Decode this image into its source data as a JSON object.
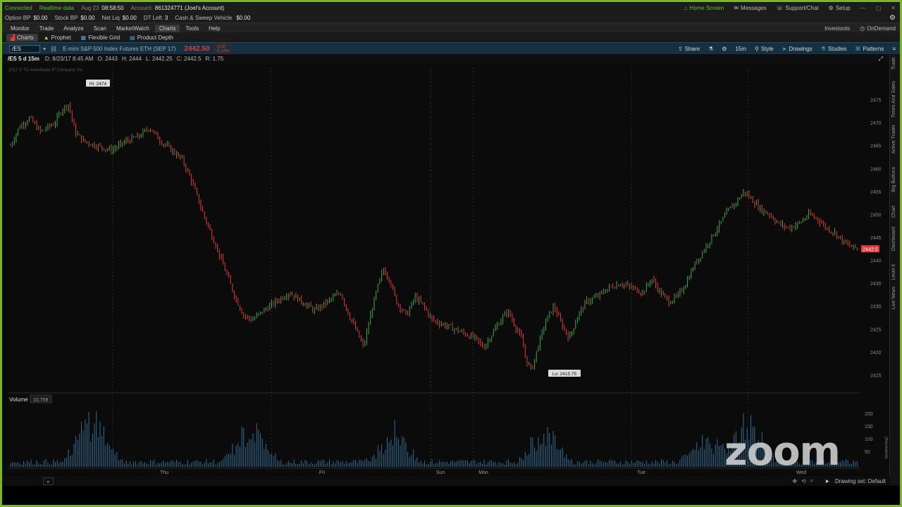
{
  "status_bar": {
    "connected": "Connected",
    "realtime": "Realtime data",
    "date": "Aug 23",
    "time": "08:58:50",
    "account_label": "Account:",
    "account": "861324771 (Joel's Account)",
    "home_screen": "Home Screen",
    "messages": "Messages",
    "support": "Support/Chat",
    "setup": "Setup"
  },
  "balances": {
    "option_bp_label": "Option BP",
    "option_bp": "$0.00",
    "stock_bp_label": "Stock BP",
    "stock_bp": "$0.00",
    "net_liq_label": "Net Liq",
    "net_liq": "$0.00",
    "dt_left_label": "DT Left",
    "dt_left": "3",
    "cash_label": "Cash & Sweep Vehicle",
    "cash": "$0.00"
  },
  "main_tabs": [
    "Monitor",
    "Trade",
    "Analyze",
    "Scan",
    "MarketWatch",
    "Charts",
    "Tools",
    "Help"
  ],
  "main_tabs_active": "Charts",
  "right_tabs": {
    "investools": "Investools",
    "ondemand": "OnDemand"
  },
  "sub_tabs": [
    "Charts",
    "Prophet",
    "Flexible Grid",
    "Product Depth"
  ],
  "symbol_bar": {
    "symbol": "/ES",
    "description": "E-mini S&P 500 Index Futures ETH (SEP 17)",
    "last": "2442.50",
    "change_top": "-3.50",
    "change_bottom": "-0.14%",
    "share": "Share",
    "timeframe": "15m",
    "style": "Style",
    "drawings": "Drawings",
    "studies": "Studies",
    "patterns": "Patterns"
  },
  "ohlc": {
    "header": "/ES 5 d 15m",
    "date": "D: 8/23/17 8:45 AM",
    "open": "O: 2443",
    "high": "H: 2444",
    "low": "L: 2442.25",
    "close": "C: 2442.5",
    "range": "R: 1.75",
    "copyright": "2017 © TD Ameritrade IP Company, Inc."
  },
  "chart_data": {
    "type": "candlestick",
    "x_labels": [
      "Thu",
      "Fri",
      "Sun",
      "Mon",
      "Tue",
      "Wed"
    ],
    "y_ticks": [
      2415,
      2420,
      2425,
      2430,
      2435,
      2440,
      2445,
      2450,
      2455,
      2460,
      2465,
      2470,
      2475
    ],
    "ylim": [
      2412,
      2482
    ],
    "hi_label": "Hi: 2474",
    "lo_label": "Lo: 2415.75",
    "last_price_tag": "2442.5",
    "path": [
      [
        0,
        2465
      ],
      [
        10,
        2469
      ],
      [
        22,
        2471
      ],
      [
        35,
        2468
      ],
      [
        52,
        2470
      ],
      [
        60,
        2473
      ],
      [
        68,
        2474
      ],
      [
        75,
        2468
      ],
      [
        85,
        2466
      ],
      [
        100,
        2465
      ],
      [
        118,
        2464
      ],
      [
        135,
        2466
      ],
      [
        150,
        2467
      ],
      [
        162,
        2469
      ],
      [
        175,
        2466
      ],
      [
        188,
        2464
      ],
      [
        200,
        2462
      ],
      [
        210,
        2458
      ],
      [
        225,
        2450
      ],
      [
        240,
        2443
      ],
      [
        252,
        2437
      ],
      [
        262,
        2432
      ],
      [
        272,
        2428
      ],
      [
        282,
        2427
      ],
      [
        295,
        2429
      ],
      [
        310,
        2431
      ],
      [
        325,
        2433
      ],
      [
        340,
        2431
      ],
      [
        355,
        2429
      ],
      [
        370,
        2431
      ],
      [
        385,
        2433
      ],
      [
        395,
        2428
      ],
      [
        405,
        2424
      ],
      [
        412,
        2421
      ],
      [
        420,
        2428
      ],
      [
        428,
        2434
      ],
      [
        435,
        2438
      ],
      [
        442,
        2436
      ],
      [
        450,
        2431
      ],
      [
        462,
        2428
      ],
      [
        472,
        2432
      ],
      [
        482,
        2430
      ],
      [
        492,
        2427
      ],
      [
        505,
        2426
      ],
      [
        518,
        2425
      ],
      [
        530,
        2424
      ],
      [
        542,
        2423
      ],
      [
        552,
        2421
      ],
      [
        562,
        2424
      ],
      [
        572,
        2427
      ],
      [
        580,
        2429
      ],
      [
        588,
        2426
      ],
      [
        596,
        2423
      ],
      [
        602,
        2418
      ],
      [
        608,
        2416
      ],
      [
        615,
        2421
      ],
      [
        625,
        2427
      ],
      [
        634,
        2430
      ],
      [
        643,
        2426
      ],
      [
        652,
        2423
      ],
      [
        662,
        2428
      ],
      [
        672,
        2431
      ],
      [
        684,
        2432
      ],
      [
        698,
        2434
      ],
      [
        712,
        2435
      ],
      [
        725,
        2434
      ],
      [
        738,
        2433
      ],
      [
        748,
        2436
      ],
      [
        758,
        2433
      ],
      [
        768,
        2431
      ],
      [
        778,
        2432
      ],
      [
        788,
        2435
      ],
      [
        798,
        2439
      ],
      [
        808,
        2442
      ],
      [
        818,
        2445
      ],
      [
        828,
        2448
      ],
      [
        838,
        2451
      ],
      [
        848,
        2453
      ],
      [
        856,
        2455
      ],
      [
        866,
        2453
      ],
      [
        876,
        2451
      ],
      [
        886,
        2450
      ],
      [
        896,
        2448
      ],
      [
        908,
        2447
      ],
      [
        920,
        2448
      ],
      [
        932,
        2450
      ],
      [
        942,
        2449
      ],
      [
        952,
        2447
      ],
      [
        962,
        2446
      ],
      [
        972,
        2444
      ],
      [
        980,
        2443
      ],
      [
        990,
        2442.5
      ]
    ],
    "volume_title": "Volume",
    "volume_value": "10,759",
    "volume_ticks": [
      "200",
      "150",
      "100",
      "50"
    ],
    "volume_unit": "(thousands)",
    "volume_peaks": [
      [
        120,
        80
      ],
      [
        345,
        60
      ],
      [
        548,
        50
      ],
      [
        762,
        55
      ],
      [
        992,
        40
      ],
      [
        1050,
        70
      ]
    ]
  },
  "sidebar_labels": [
    "Trade",
    "Times And Sales",
    "Active Trader",
    "Big Buttons",
    "Chart",
    "Dashboard",
    "Level II",
    "Live News"
  ],
  "bottom": {
    "drawing_set": "Drawing set: Default"
  },
  "overlay": {
    "zoom": "zoom"
  },
  "colors": {
    "frame": "#7db52a",
    "up": "#3fa84a",
    "down": "#e03c3c",
    "last_tag": "#e23b3b"
  }
}
